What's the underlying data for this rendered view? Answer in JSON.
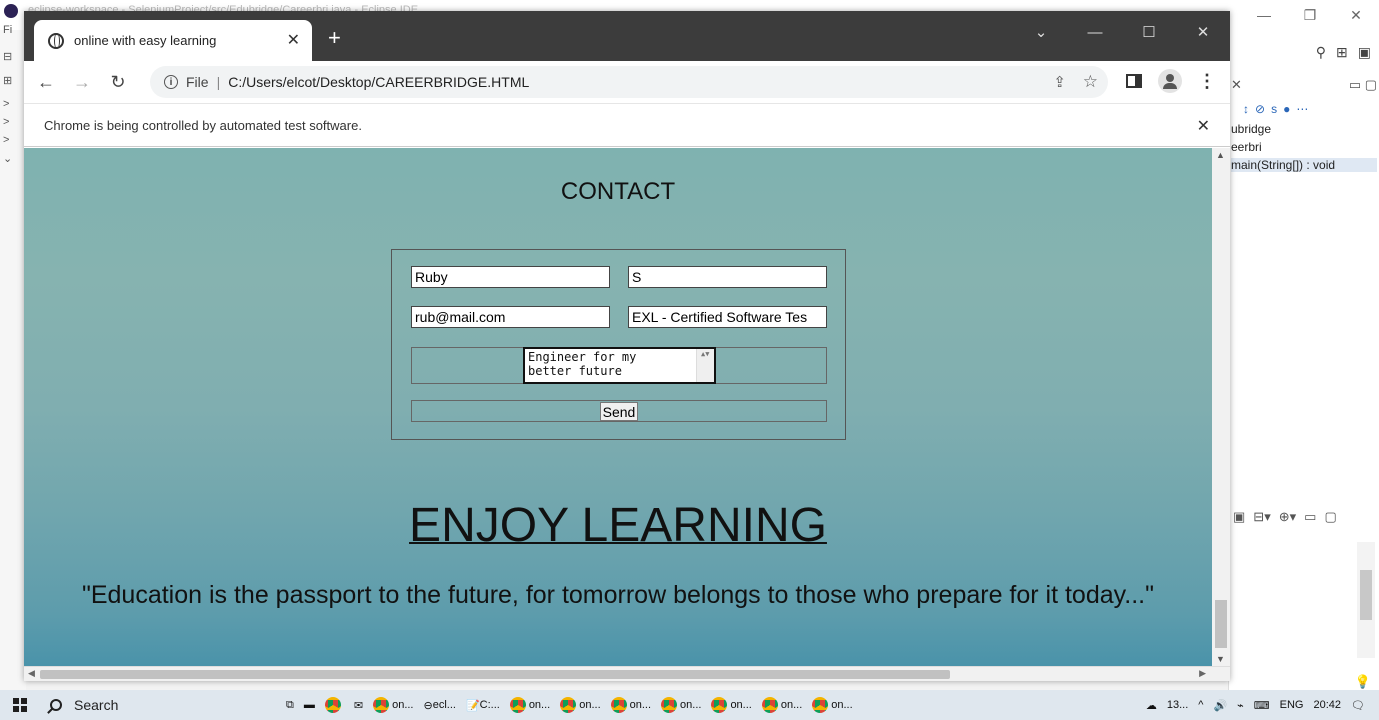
{
  "eclipse": {
    "title": "eclipse-workspace - SeleniumProject/src/Edubridge/Careerbri.java - Eclipse IDE",
    "left_strip": [
      "Fi",
      "⊟",
      "⊞",
      ">",
      ">",
      ">",
      "⌄"
    ],
    "outline": [
      "ubridge",
      "eerbri",
      "main(String[]) : void"
    ]
  },
  "chrome": {
    "tab_title": "online with easy learning",
    "new_tab": "+",
    "url_scheme": "File",
    "url_path": "C:/Users/elcot/Desktop/CAREERBRIDGE.HTML",
    "infobar_text": "Chrome is being controlled by automated test software."
  },
  "page": {
    "contact_heading": "CONTACT",
    "first_name": "Ruby",
    "last_name": "S",
    "email": "rub@mail.com",
    "course": "EXL - Certified Software Tes",
    "message": "Engineer for my\nbetter future",
    "send_label": "Send",
    "enjoy_heading": "ENJOY LEARNING",
    "quote": "\"Education is the passport to the future, for tomorrow belongs to those who prepare for it today...\""
  },
  "taskbar": {
    "search_label": "Search",
    "apps": [
      "on...",
      "ecl...",
      "C:...",
      "on...",
      "on...",
      "on...",
      "on...",
      "on...",
      "on...",
      "on..."
    ],
    "weather": "13...",
    "language": "ENG",
    "time": "20:42"
  },
  "colors": {
    "page_gradient_top": "#7fb2b0",
    "page_gradient_bottom": "#4a93aa",
    "tabstrip": "#3c3c3c"
  }
}
